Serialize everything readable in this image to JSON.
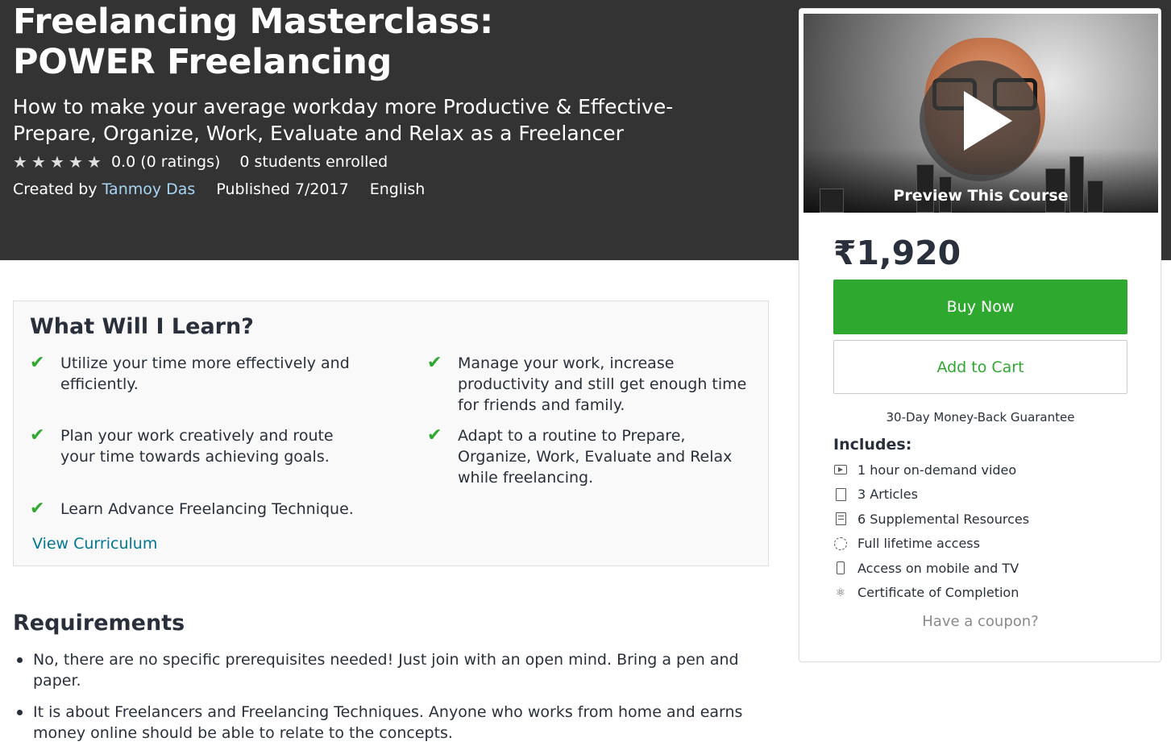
{
  "course": {
    "title": "Freelancing Masterclass: POWER Freelancing",
    "subtitle": "How to make your average workday more Productive & Effective-Prepare, Organize, Work, Evaluate and Relax as a Freelancer",
    "rating": 0.0,
    "rating_text": "0.0 (0 ratings)",
    "stars": 5,
    "students": "0 students enrolled",
    "created_by_label": "Created by",
    "author": "Tanmoy Das",
    "published": "Published 7/2017",
    "language": "English"
  },
  "sidebar": {
    "preview_label": "Preview This Course",
    "price": "₹1,920",
    "buy_now": "Buy Now",
    "add_to_cart": "Add to Cart",
    "guarantee": "30-Day Money-Back Guarantee",
    "includes_title": "Includes:",
    "includes": [
      {
        "icon": "video-icon",
        "label": "1 hour on-demand video"
      },
      {
        "icon": "file-icon",
        "label": "3 Articles"
      },
      {
        "icon": "document-icon",
        "label": "6 Supplemental Resources"
      },
      {
        "icon": "infinity-icon",
        "label": "Full lifetime access"
      },
      {
        "icon": "mobile-icon",
        "label": "Access on mobile and TV"
      },
      {
        "icon": "certificate-icon",
        "label": "Certificate of Completion"
      }
    ],
    "coupon": "Have a coupon?"
  },
  "learn": {
    "title": "What Will I Learn?",
    "items": [
      "Utilize your time more effectively and efficiently.",
      "Manage your work, increase productivity and still get enough time for friends and family.",
      "Plan your work creatively and route your time towards achieving goals.",
      "Adapt to a routine to Prepare, Organize, Work, Evaluate and Relax while freelancing.",
      "Learn Advance Freelancing Technique."
    ],
    "view_curriculum": "View Curriculum"
  },
  "requirements": {
    "title": "Requirements",
    "items": [
      "No, there are no specific prerequisites needed! Just join with an open mind. Bring a pen and paper.",
      "It is about Freelancers and Freelancing Techniques. Anyone who works from home and earns money online should be able to relate to the concepts."
    ]
  },
  "colors": {
    "hero_bg": "#333333",
    "buy_green": "#2fa82f",
    "link_blue": "#007791",
    "author_link": "#a7d6f5"
  }
}
